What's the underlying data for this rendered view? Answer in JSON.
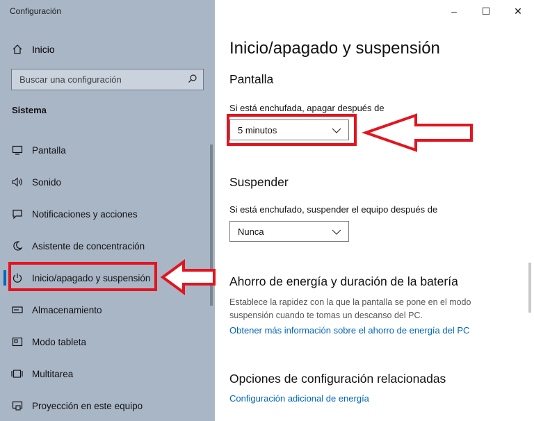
{
  "window": {
    "title": "Configuración",
    "controls": {
      "minimize": "–",
      "maximize": "☐",
      "close": "✕"
    }
  },
  "sidebar": {
    "home_label": "Inicio",
    "search_placeholder": "Buscar una configuración",
    "section_title": "Sistema",
    "items": [
      {
        "label": "Pantalla",
        "icon": "monitor-icon",
        "active": false
      },
      {
        "label": "Sonido",
        "icon": "speaker-icon",
        "active": false
      },
      {
        "label": "Notificaciones y acciones",
        "icon": "notification-icon",
        "active": false
      },
      {
        "label": "Asistente de concentración",
        "icon": "moon-icon",
        "active": false
      },
      {
        "label": "Inicio/apagado y suspensión",
        "icon": "power-icon",
        "active": true
      },
      {
        "label": "Almacenamiento",
        "icon": "storage-icon",
        "active": false
      },
      {
        "label": "Modo tableta",
        "icon": "tablet-icon",
        "active": false
      },
      {
        "label": "Multitarea",
        "icon": "multitask-icon",
        "active": false
      },
      {
        "label": "Proyección en este equipo",
        "icon": "projection-icon",
        "active": false
      }
    ]
  },
  "main": {
    "title": "Inicio/apagado y suspensión",
    "screen": {
      "heading": "Pantalla",
      "label": "Si está enchufada, apagar después de",
      "value": "5 minutos"
    },
    "sleep": {
      "heading": "Suspender",
      "label": "Si está enchufado, suspender el equipo después de",
      "value": "Nunca"
    },
    "battery": {
      "heading": "Ahorro de energía y duración de la batería",
      "description": "Establece la rapidez con la que la pantalla se pone en el modo suspensión cuando te tomas un descanso del PC.",
      "link": "Obtener más información sobre el ahorro de energía del PC"
    },
    "related": {
      "heading": "Opciones de configuración relacionadas",
      "link": "Configuración adicional de energía"
    }
  },
  "colors": {
    "sidebar_bg": "#a9b6c6",
    "accent": "#0067c0",
    "link": "#0066b4",
    "annotation": "#e3141f"
  }
}
